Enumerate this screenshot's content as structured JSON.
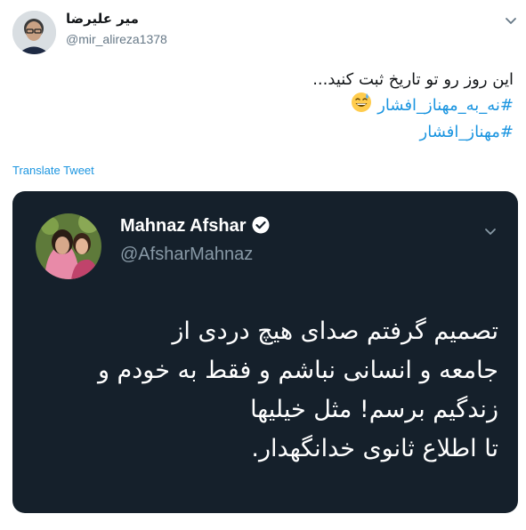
{
  "tweet": {
    "display_name": "میر علیرضا",
    "handle": "@mir_alireza1378",
    "avatar": "profile-photo",
    "text_line": "این روز رو تو تاریخ ثبت کنید...",
    "hashtag_1": "#نه_به_مهناز_افشار",
    "hashtag_2": "#مهناز_افشار",
    "emoji": "grinning-face-with-sweat-emoji",
    "translate_label": "Translate Tweet",
    "menu_icon": "chevron-down-icon"
  },
  "quoted": {
    "display_name": "Mahnaz Afshar",
    "handle": "@AfsharMahnaz",
    "verified_icon": "verified-badge-icon",
    "menu_icon": "chevron-down-icon",
    "lines": [
      "تصمیم گرفتم صدای هیچ دردی از",
      "جامعه و انسانی نباشم و فقط به خودم و",
      "زندگیم برسم! مثل خیلیها",
      "تا اطلاع ثانوی خدانگهدار."
    ],
    "background_color": "#15202b"
  },
  "colors": {
    "link": "#1b95e0",
    "text": "#14171a",
    "muted": "#657786"
  }
}
